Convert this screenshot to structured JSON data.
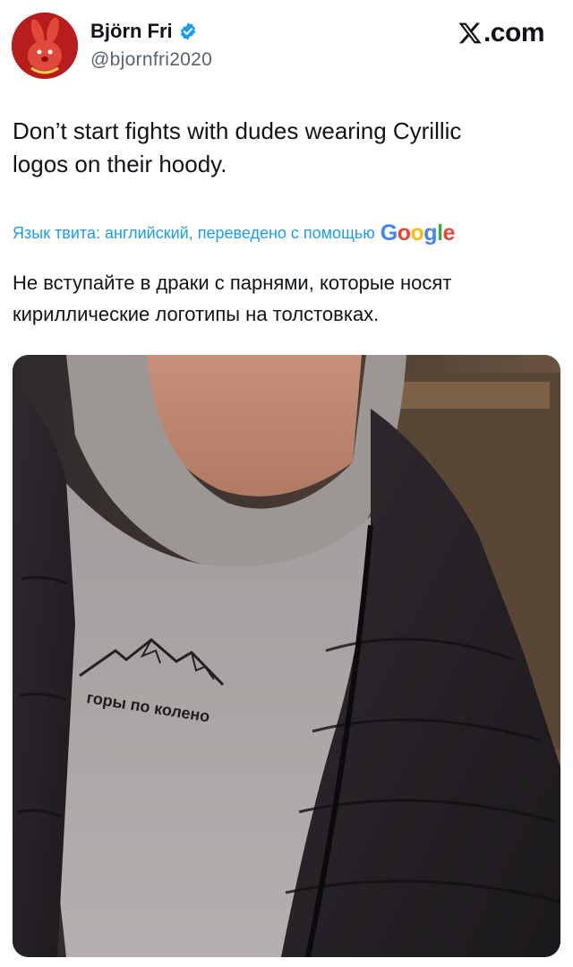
{
  "author": {
    "name": "Björn Fri",
    "handle": "@bjornfri2020"
  },
  "brand": {
    "label": ".com"
  },
  "tweet": {
    "text": "Don’t start fights with dudes wearing Cyrillic\nlogos on their hoody.",
    "translation_note": "Язык твита: английский, переведено с помощью",
    "translation_provider": "Google",
    "translated_text": "Не вступайте в драки с парнями, которые носят\nкириллические логотипы на толстовках."
  },
  "media": {
    "shirt_print_text": "горы по колено"
  },
  "colors": {
    "link": "#1d9bf0",
    "secondary_text": "#536471",
    "verified": "#1d9bf0"
  }
}
